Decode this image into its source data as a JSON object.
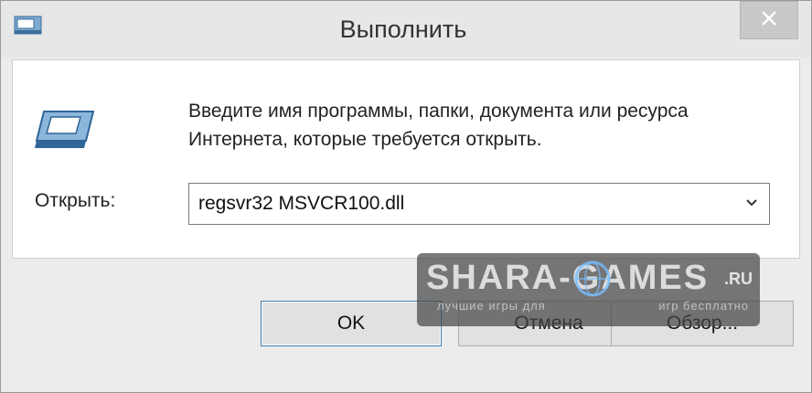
{
  "window": {
    "title": "Выполнить"
  },
  "icons": {
    "app": "run-app-icon",
    "close": "close-icon",
    "dropdown": "chevron-down-icon"
  },
  "content": {
    "description": "Введите имя программы, папки, документа или ресурса Интернета, которые требуется открыть.",
    "open_label": "Открыть:",
    "open_value": "regsvr32 MSVCR100.dll"
  },
  "buttons": {
    "ok": "OK",
    "cancel": "Отмена",
    "browse": "Обзор..."
  },
  "watermark": {
    "text": "SHARA-GAMES",
    "suffix": ".RU",
    "tagline_left": "лучшие игры для",
    "tagline_right": "игр бесплатно"
  },
  "colors": {
    "accent_border": "#3c7fb1",
    "titlebar": "#e7e7e7",
    "client_bg": "#ffffff"
  }
}
